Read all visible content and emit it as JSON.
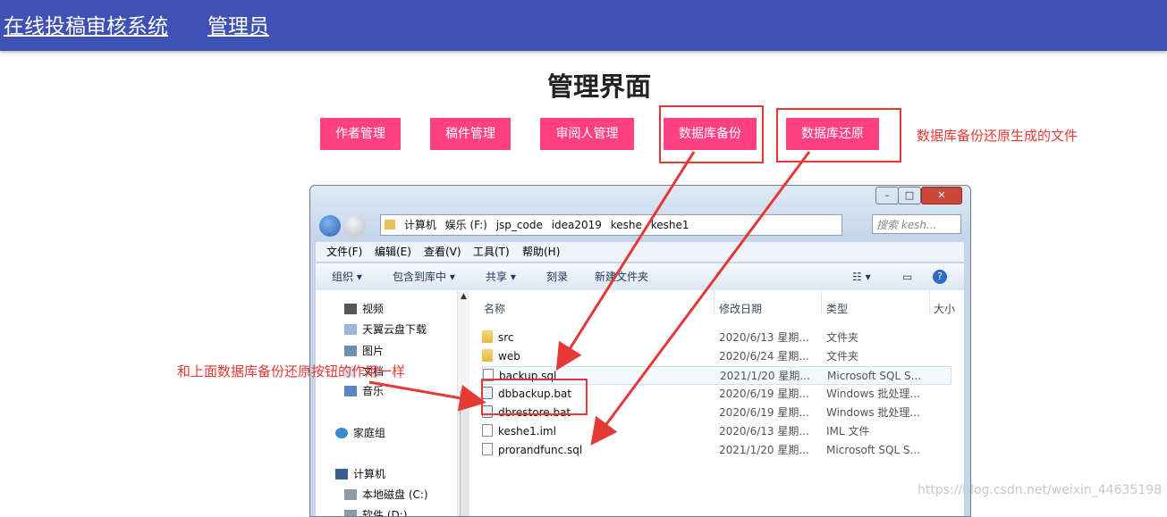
{
  "header": {
    "system_title": "在线投稿审核系统",
    "role": "管理员"
  },
  "page_title": "管理界面",
  "buttons": [
    {
      "label": "作者管理"
    },
    {
      "label": "稿件管理"
    },
    {
      "label": "审阅人管理"
    },
    {
      "label": "数据库备份"
    },
    {
      "label": "数据库还原"
    }
  ],
  "annotations": {
    "top": "数据库备份还原生成的文件",
    "left": "和上面数据库备份还原按钮的作用一样"
  },
  "explorer": {
    "window_controls": [
      "–",
      "□",
      "✕"
    ],
    "address": [
      "计算机",
      "娱乐 (F:)",
      "jsp_code",
      "idea2019",
      "keshe",
      "keshe1"
    ],
    "search_placeholder": "搜索 kesh...",
    "menu": [
      "文件(F)",
      "编辑(E)",
      "查看(V)",
      "工具(T)",
      "帮助(H)"
    ],
    "commands": [
      "组织 ▾",
      "包含到库中 ▾",
      "共享 ▾",
      "刻录",
      "新建文件夹"
    ],
    "nav_items": [
      "视频",
      "天翼云盘下载",
      "图片",
      "文档",
      "音乐",
      "家庭组",
      "计算机",
      "本地磁盘 (C:)",
      "软件 (D:)"
    ],
    "columns": [
      "名称",
      "修改日期",
      "类型",
      "大小"
    ],
    "files": [
      {
        "name": "src",
        "date": "2020/6/13 星期...",
        "type": "文件夹",
        "icon": "folder-icon"
      },
      {
        "name": "web",
        "date": "2020/6/24 星期...",
        "type": "文件夹",
        "icon": "folder-icon"
      },
      {
        "name": "backup.sql",
        "date": "2021/1/20 星期...",
        "type": "Microsoft SQL S...",
        "icon": "sql-file-icon"
      },
      {
        "name": "dbbackup.bat",
        "date": "2020/6/19 星期...",
        "type": "Windows 批处理...",
        "icon": "bat-file-icon"
      },
      {
        "name": "dbrestore.bat",
        "date": "2020/6/19 星期...",
        "type": "Windows 批处理...",
        "icon": "bat-file-icon"
      },
      {
        "name": "keshe1.iml",
        "date": "2020/6/13 星期...",
        "type": "IML 文件",
        "icon": "file-icon"
      },
      {
        "name": "prorandfunc.sql",
        "date": "2021/1/20 星期...",
        "type": "Microsoft SQL S...",
        "icon": "sql-file-icon"
      }
    ]
  },
  "watermark": "https://blog.csdn.net/weixin_44635198",
  "colors": {
    "topbar": "#3f51b5",
    "button": "#ff4081",
    "annotation": "#e53935"
  }
}
